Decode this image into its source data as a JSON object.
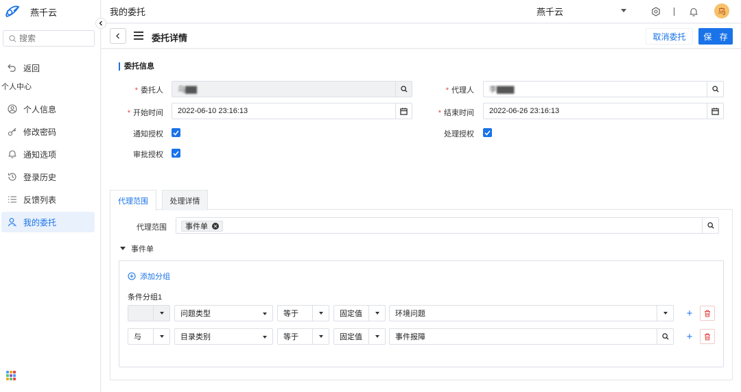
{
  "sidebar": {
    "brand": "燕千云",
    "search_placeholder": "搜索",
    "back_label": "返回",
    "group_label": "个人中心",
    "items": [
      {
        "label": "个人信息",
        "icon": "user-circle-icon"
      },
      {
        "label": "修改密码",
        "icon": "key-icon"
      },
      {
        "label": "通知选项",
        "icon": "bell-icon"
      },
      {
        "label": "登录历史",
        "icon": "history-icon"
      },
      {
        "label": "反馈列表",
        "icon": "list-icon"
      },
      {
        "label": "我的委托",
        "icon": "delegate-user-icon",
        "active": true
      }
    ]
  },
  "topbar": {
    "title": "我的委托",
    "tenant": "燕千云",
    "avatar_text": "乌"
  },
  "subbar": {
    "title": "委托详情",
    "cancel_label": "取消委托",
    "save_label": "保 存"
  },
  "form": {
    "section_title": "委托信息",
    "delegator_label": "委托人",
    "delegator_value": "乌▇▇",
    "agent_label": "代理人",
    "agent_value": "李▇▇▇",
    "start_label": "开始时间",
    "start_value": "2022-06-10 23:16:13",
    "end_label": "结束时间",
    "end_value": "2022-06-26 23:16:13",
    "notify_label": "通知授权",
    "notify_checked": true,
    "process_label": "处理授权",
    "process_checked": true,
    "approve_label": "审批授权",
    "approve_checked": true
  },
  "tabs": [
    {
      "label": "代理范围",
      "active": true
    },
    {
      "label": "处理详情",
      "active": false
    }
  ],
  "scope": {
    "label": "代理范围",
    "tag": "事件单",
    "collapse_label": "事件单",
    "add_group_label": "添加分组",
    "group_title": "条件分组1",
    "rows": [
      {
        "logic": "",
        "field": "问题类型",
        "op": "等于",
        "value_type": "固定值",
        "value": "环境问题",
        "value_kind": "select"
      },
      {
        "logic": "与",
        "field": "目录类别",
        "op": "等于",
        "value_type": "固定值",
        "value": "事件报障",
        "value_kind": "search"
      }
    ]
  },
  "colors": {
    "primary": "#1a73e8",
    "required": "#e64545",
    "danger": "#e64545"
  }
}
